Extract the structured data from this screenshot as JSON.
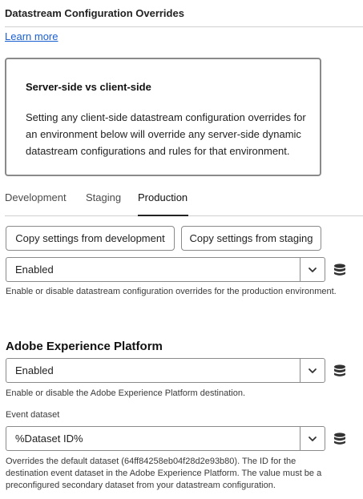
{
  "header": {
    "title": "Datastream Configuration Overrides",
    "learn_more": "Learn more"
  },
  "info_box": {
    "title": "Server-side vs client-side",
    "body": "Setting any client-side datastream configuration overrides for an environment below will override any server-side dynamic datastream configurations and rules for that environment."
  },
  "tabs": [
    {
      "label": "Development",
      "active": false
    },
    {
      "label": "Staging",
      "active": false
    },
    {
      "label": "Production",
      "active": true
    }
  ],
  "buttons": {
    "copy_dev": "Copy settings from development",
    "copy_staging": "Copy settings from staging"
  },
  "overrides": {
    "value": "Enabled",
    "help": "Enable or disable datastream configuration overrides for the production environment."
  },
  "aep": {
    "heading": "Adobe Experience Platform",
    "value": "Enabled",
    "help": "Enable or disable the Adobe Experience Platform destination."
  },
  "event_dataset": {
    "label": "Event dataset",
    "value": "%Dataset ID%",
    "help": "Overrides the default dataset (64ff84258eb04f28d2e93b80). The ID for the destination event dataset in the Adobe Experience Platform. The value must be a preconfigured secondary dataset from your datastream configuration."
  },
  "icons": {
    "chevron": "chevron-down-icon",
    "data_element": "database-icon"
  },
  "colors": {
    "link": "#1a5fd0",
    "border": "#8a8a8a",
    "divider": "#d0d0d0"
  }
}
